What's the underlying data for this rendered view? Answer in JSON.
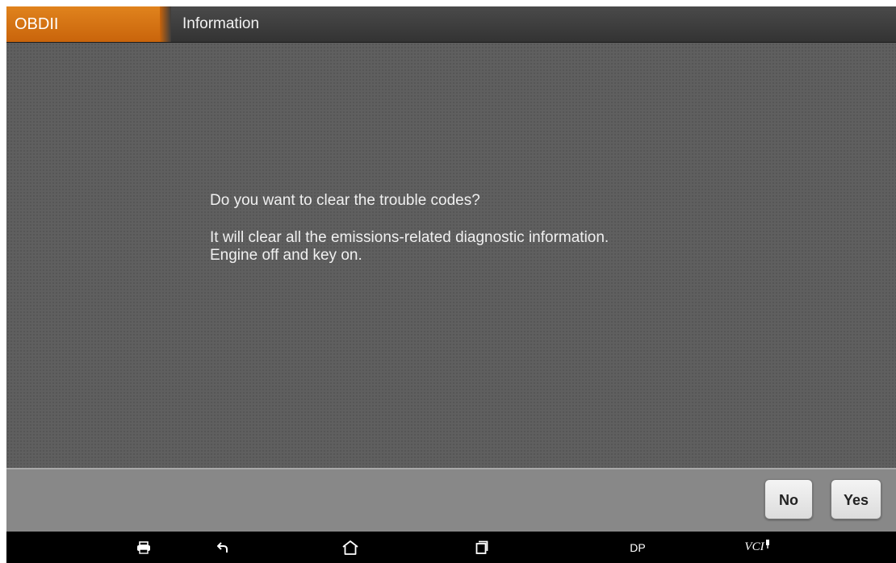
{
  "header": {
    "brand": "OBDII",
    "title": "Information"
  },
  "dialog": {
    "question": "Do you want to clear the trouble codes?",
    "detail_line1": "It will clear all the emissions-related diagnostic information.",
    "detail_line2": "Engine off and key on."
  },
  "actions": {
    "no_label": "No",
    "yes_label": "Yes"
  },
  "navbar": {
    "items": [
      "printer-icon",
      "back-icon",
      "home-icon",
      "recent-apps-icon"
    ],
    "dp_label": "DP",
    "vci_label": "VCI"
  },
  "colors": {
    "brand_orange": "#d8750f",
    "background": "#5f5f5f",
    "footer": "#888888"
  }
}
